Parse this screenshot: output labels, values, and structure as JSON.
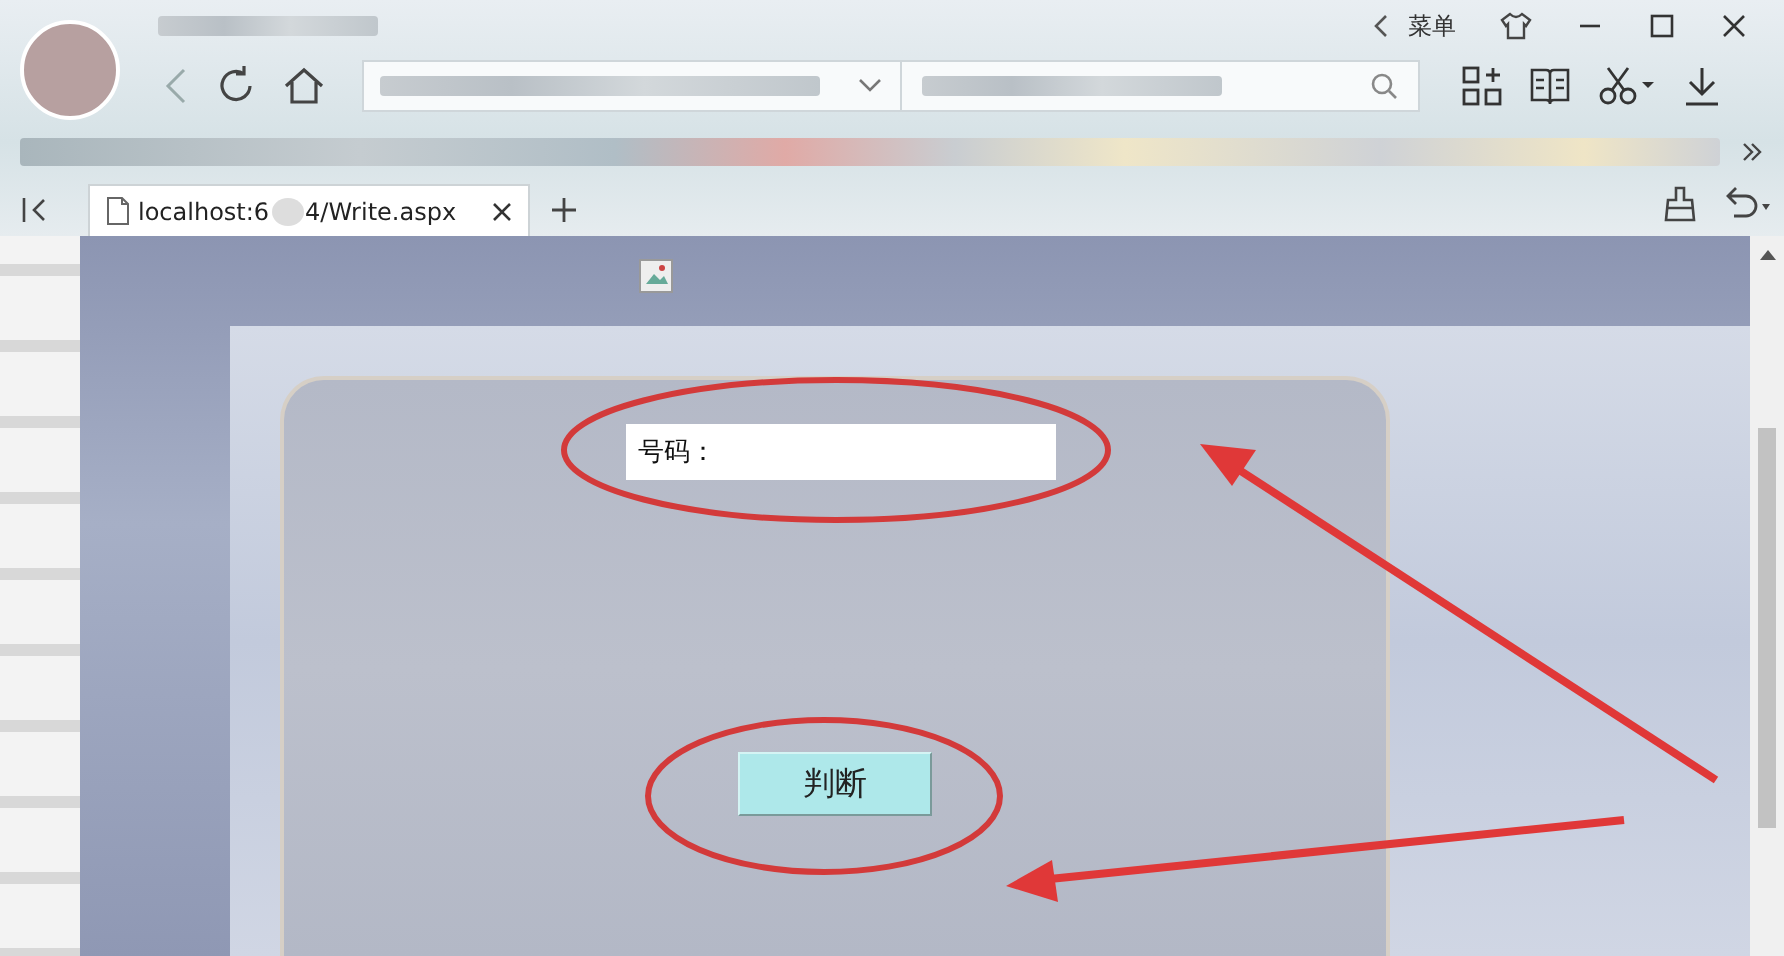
{
  "browser": {
    "menu_label": "菜单"
  },
  "tab": {
    "title_start": "localhost:6",
    "title_end": "4/Write.aspx"
  },
  "form": {
    "field_value": "号码：",
    "button_label": "判断"
  }
}
